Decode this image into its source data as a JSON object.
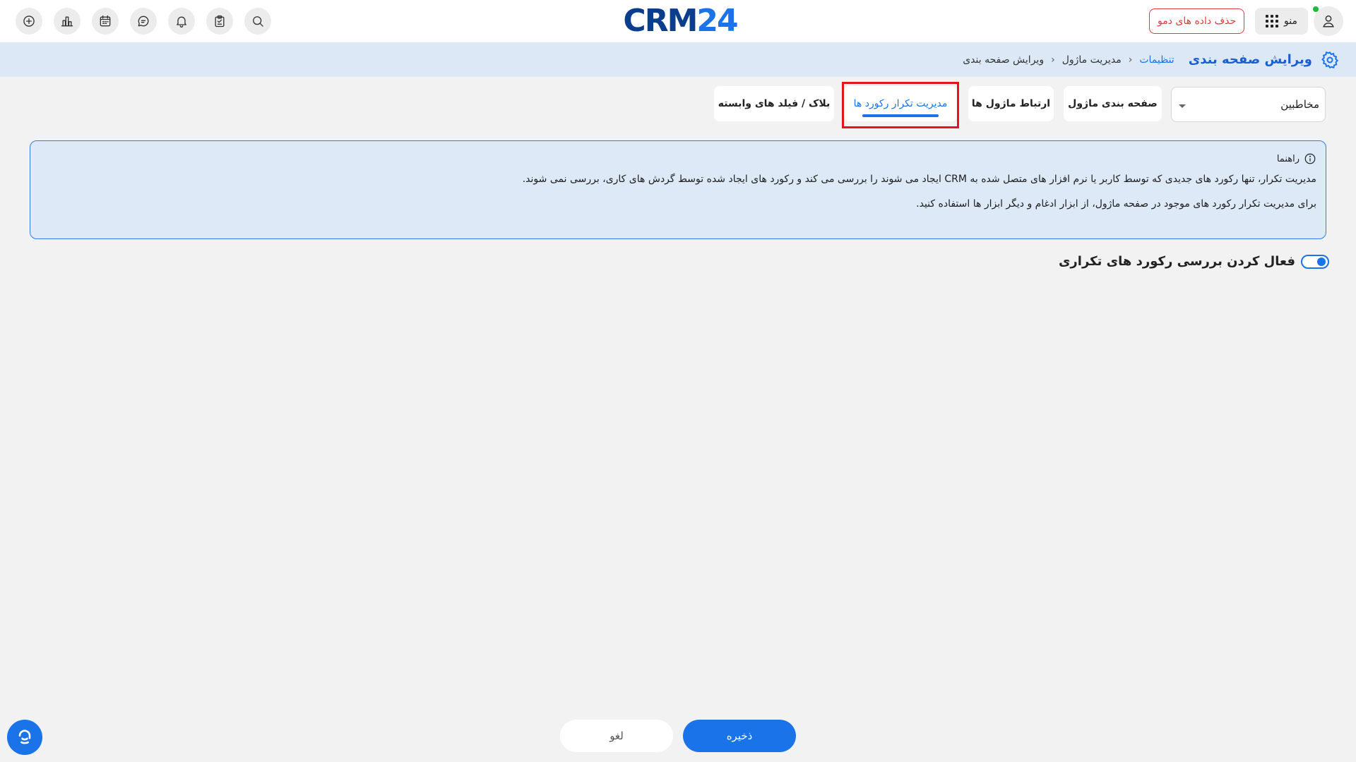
{
  "header": {
    "logo_part1": "CRM",
    "logo_part2": "24",
    "demo_button": "حذف داده های دمو",
    "menu_label": "منو",
    "icons": [
      "add-icon",
      "chart-icon",
      "calendar-icon",
      "chat-icon",
      "bell-icon",
      "clipboard-icon",
      "search-icon",
      "user-icon",
      "apps-grid-icon"
    ]
  },
  "breadcrumb": {
    "page_title": "ویرایش صفحه بندی",
    "items": [
      "تنظیمات",
      "مدیریت ماژول",
      "ویرایش صفحه بندی"
    ],
    "separator": "‹"
  },
  "module_select": {
    "value": "مخاطبین"
  },
  "tabs": [
    {
      "label": "صفحه بندی ماژول",
      "active": false
    },
    {
      "label": "ارتباط ماژول ها",
      "active": false
    },
    {
      "label": "مدیریت تکرار رکورد ها",
      "active": true
    },
    {
      "label": "بلاک / فیلد های وابسته",
      "active": false
    }
  ],
  "help": {
    "title": "راهنما",
    "line1": "مدیریت تکرار، تنها رکورد های جدیدی که توسط کاربر یا نرم افزار های متصل شده به CRM ایجاد می شوند را بررسی می کند و رکورد های ایجاد شده توسط گردش های کاری، بررسی نمی شوند.",
    "line2": "برای مدیریت تکرار رکورد های موجود در صفحه ماژول، از ابزار ادغام و دیگر ابزار ها استفاده کنید."
  },
  "duplicate_check": {
    "label": "فعال کردن بررسی رکورد های تکراری",
    "enabled": true
  },
  "footer": {
    "save": "ذخیره",
    "cancel": "لغو"
  },
  "colors": {
    "accent": "#1a73e8",
    "danger": "#e0393e",
    "highlight": "#e3141c",
    "online": "#1dbb3a"
  }
}
